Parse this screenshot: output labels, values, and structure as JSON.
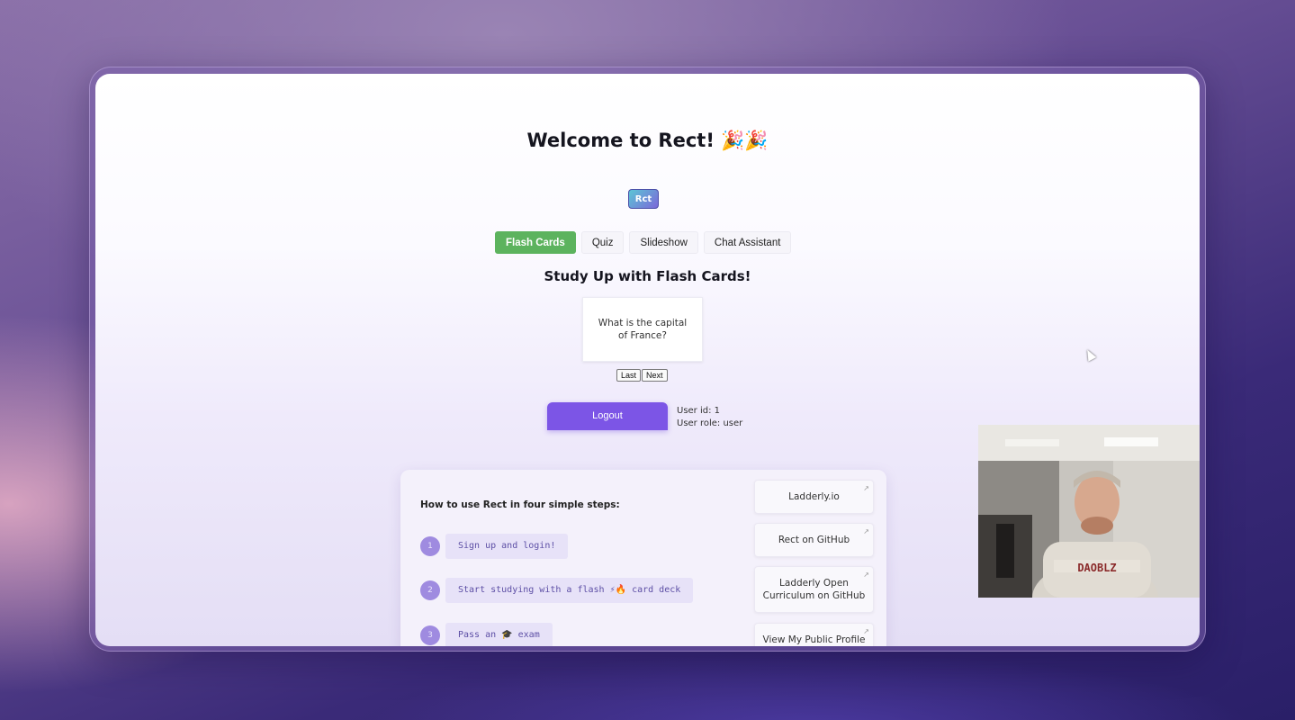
{
  "app": {
    "title": "Welcome to Rect! 🎉🎉",
    "logo_text": "Rct"
  },
  "tabs": [
    {
      "label": "Flash Cards",
      "active": true
    },
    {
      "label": "Quiz",
      "active": false
    },
    {
      "label": "Slideshow",
      "active": false
    },
    {
      "label": "Chat Assistant",
      "active": false
    }
  ],
  "flashcards": {
    "heading": "Study Up with Flash Cards!",
    "question": "What is the capital of France?",
    "last_label": "Last",
    "next_label": "Next"
  },
  "user": {
    "logout_label": "Logout",
    "id_text": "User id: 1",
    "role_text": "User role: user"
  },
  "steps": {
    "title": "How to use Rect in four simple steps:",
    "items": [
      {
        "num": "1",
        "text": "Sign up and login!"
      },
      {
        "num": "2",
        "text": "Start studying with a flash ⚡🔥 card deck"
      },
      {
        "num": "3",
        "text": "Pass an 🎓 exam"
      }
    ]
  },
  "links": [
    {
      "label": "Ladderly.io",
      "icon": "external-link-icon"
    },
    {
      "label": "Rect on GitHub",
      "icon": "external-link-icon"
    },
    {
      "label": "Ladderly Open Curriculum on GitHub",
      "icon": "external-link-icon"
    },
    {
      "label": "View My Public Profile",
      "icon": "external-link-icon"
    }
  ],
  "webcam": {
    "shirt_text": "DAOBLZ"
  },
  "colors": {
    "active_tab": "#5cb35e",
    "logout": "#7c55e6",
    "step_badge": "#9f8be0",
    "step_text": "#5d4fa5"
  }
}
